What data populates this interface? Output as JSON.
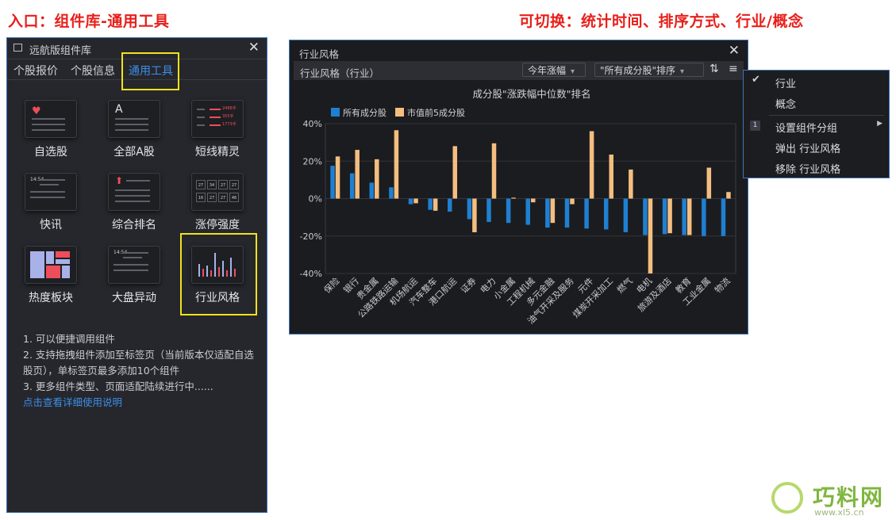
{
  "annotations": {
    "left": "入口：组件库-通用工具",
    "right": "可切换：统计时间、排序方式、行业/概念"
  },
  "library": {
    "title": "远航版组件库",
    "tabs": [
      {
        "label": "个股报价"
      },
      {
        "label": "个股信息"
      },
      {
        "label": "通用工具"
      }
    ],
    "tiles": [
      {
        "label": "自选股"
      },
      {
        "label": "全部A股",
        "glyph": "A"
      },
      {
        "label": "短线精灵",
        "lines": [
          "2488手",
          "355手",
          "1773手"
        ]
      },
      {
        "label": "快讯",
        "time": "14:54"
      },
      {
        "label": "综合排名"
      },
      {
        "label": "涨停强度",
        "cells": [
          "27",
          "34",
          "27",
          "27",
          "16",
          "27",
          "27",
          "46"
        ]
      },
      {
        "label": "热度板块"
      },
      {
        "label": "大盘异动",
        "time": "14:54"
      },
      {
        "label": "行业风格"
      }
    ],
    "notes": [
      "1. 可以便捷调用组件",
      "2. 支持拖拽组件添加至标签页（当前版本仅适配自选股页），单标签页最多添加10个组件",
      "3. 更多组件类型、页面适配陆续进行中......"
    ],
    "link": "点击查看详细使用说明"
  },
  "window": {
    "title": "行业风格",
    "subtitle": "行业风格（行业）",
    "period": "今年涨幅",
    "sort": "\"所有成分股\"排序",
    "sort_icon": "sort-descending-icon",
    "menu_icon": "hamburger-icon"
  },
  "menu": {
    "items": [
      "行业",
      "概念",
      "设置组件分组",
      "弹出 行业风格",
      "移除 行业风格"
    ],
    "badge": "1"
  },
  "watermark": {
    "name": "巧料网",
    "url": "www.xl5.cn"
  },
  "colors": {
    "accent": "#3d8ee8",
    "series1": "#1f7fd1",
    "series2": "#f4be80",
    "highlight": "#f2e21b",
    "annotation": "#e8201c"
  },
  "chart_data": {
    "type": "bar",
    "title": "成分股\"涨跌幅中位数\"排名",
    "ylim": [
      -40,
      40
    ],
    "yticks": [
      "40%",
      "20%",
      "0%",
      "-20%",
      "-40%"
    ],
    "categories": [
      "保险",
      "银行",
      "贵金属",
      "公路铁路运输",
      "机场航运",
      "汽车整车",
      "港口航运",
      "证券",
      "电力",
      "小金属",
      "工程机械",
      "多元金融",
      "油气开采及服务",
      "元件",
      "煤炭开采加工",
      "燃气",
      "电机",
      "旅游及酒店",
      "教育",
      "工业金属",
      "物流"
    ],
    "series": [
      {
        "name": "所有成分股",
        "values": [
          17.5,
          13.5,
          8.5,
          6,
          -3,
          -6,
          -7,
          -11,
          -12.5,
          -13,
          -14,
          -15.5,
          -15.5,
          -16,
          -16.5,
          -18,
          -19.5,
          -19,
          -19.5,
          -20,
          -20
        ]
      },
      {
        "name": "市值前5成分股",
        "values": [
          22.5,
          26,
          21,
          36.5,
          -2.5,
          -6.5,
          28,
          -18,
          29.5,
          0.5,
          -2,
          -13,
          -3,
          36,
          23.5,
          15.5,
          -40,
          -18.5,
          -19.5,
          16.5,
          3.5
        ]
      }
    ],
    "legend": "top-left",
    "grid": true
  }
}
